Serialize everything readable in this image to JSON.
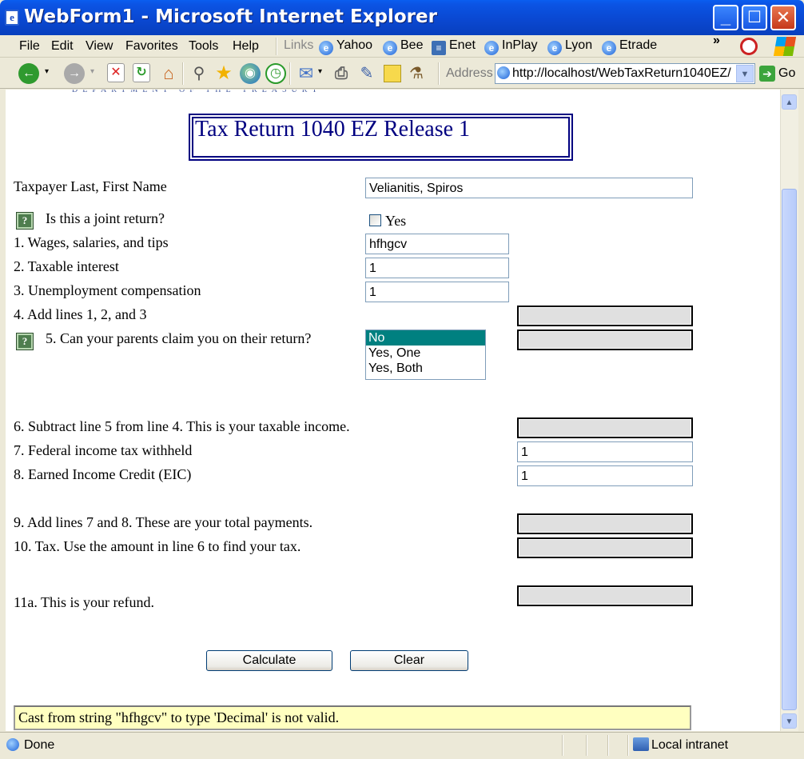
{
  "window": {
    "title": "WebForm1 - Microsoft Internet Explorer"
  },
  "menu": [
    "File",
    "Edit",
    "View",
    "Favorites",
    "Tools",
    "Help"
  ],
  "links": {
    "label": "Links",
    "items": [
      "Yahoo",
      "Bee",
      "Enet",
      "InPlay",
      "Lyon",
      "Etrade"
    ],
    "more": "»"
  },
  "address": {
    "label": "Address",
    "url": "http://localhost/WebTaxReturn1040EZ/",
    "go": "Go"
  },
  "page": {
    "banner_fragment": "DEPARTMENT OF THE TREASURY",
    "title": "Tax Return 1040 EZ Release 1",
    "name_label": "Taxpayer Last, First Name",
    "name_value": "Velianitis, Spiros",
    "joint_label": "Is this a joint return?",
    "joint_option": "Yes",
    "line1_label": "1. Wages, salaries, and tips",
    "line1_value": "hfhgcv",
    "line2_label": "2. Taxable interest",
    "line2_value": "1",
    "line3_label": "3. Unemployment compensation",
    "line3_value": "1",
    "line4_label": "4. Add lines 1, 2, and 3",
    "line5_label": "5. Can your parents claim you on their return?",
    "line5_options": [
      "No",
      "Yes, One",
      "Yes, Both"
    ],
    "line5_selected": "No",
    "line6_label": "6. Subtract line 5 from line 4. This is your taxable income.",
    "line7_label": "7. Federal income tax withheld",
    "line7_value": "1",
    "line8_label": "8. Earned Income Credit (EIC)",
    "line8_value": "1",
    "line9_label": "9. Add lines 7 and 8. These are your total payments.",
    "line10_label": "10. Tax. Use the amount in line 6 to find your tax.",
    "line11_label": "11a. This is your refund.",
    "calculate": "Calculate",
    "clear": "Clear",
    "error": "Cast from string \"hfhgcv\" to type 'Decimal' is not valid."
  },
  "status": {
    "left": "Done",
    "zone": "Local intranet"
  }
}
